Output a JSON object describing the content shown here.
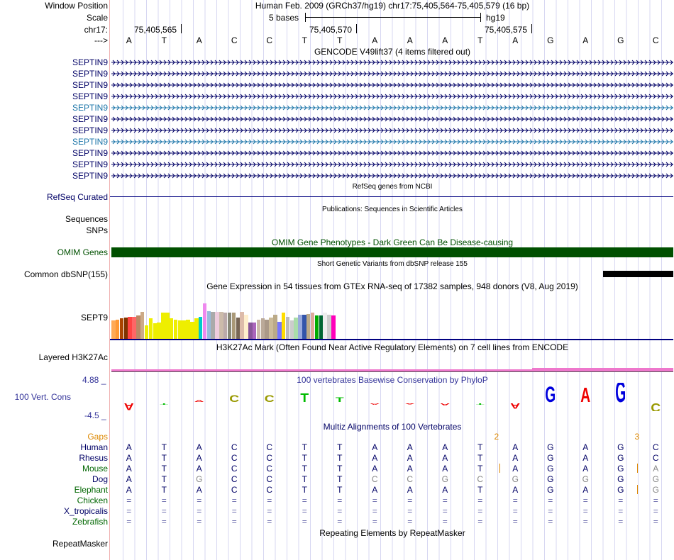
{
  "header": {
    "window_position_label": "Window Position",
    "position_text": "Human Feb. 2009 (GRCh37/hg19)   chr17:75,405,564-75,405,579 (16 bp)",
    "scale_label": "Scale",
    "scale_text": "5 bases",
    "assembly": "hg19",
    "chrom_label": "chr17:",
    "arrow_label": "--->",
    "coords": [
      "75,405,565",
      "75,405,570",
      "75,405,575"
    ]
  },
  "sequence": [
    "A",
    "T",
    "A",
    "C",
    "C",
    "T",
    "T",
    "A",
    "A",
    "A",
    "T",
    "A",
    "G",
    "A",
    "G",
    "C"
  ],
  "gencode": {
    "title": "GENCODE V49lift37 (4 items filtered out)",
    "rows": [
      {
        "label": "SEPTIN9",
        "color": "#000066"
      },
      {
        "label": "SEPTIN9",
        "color": "#000066"
      },
      {
        "label": "SEPTIN9",
        "color": "#000066"
      },
      {
        "label": "SEPTIN9",
        "color": "#000066"
      },
      {
        "label": "SEPTIN9",
        "color": "#1a74a8"
      },
      {
        "label": "SEPTIN9",
        "color": "#000066"
      },
      {
        "label": "SEPTIN9",
        "color": "#000066"
      },
      {
        "label": "SEPTIN9",
        "color": "#1a74a8"
      },
      {
        "label": "SEPTIN9",
        "color": "#000066"
      },
      {
        "label": "SEPTIN9",
        "color": "#000066"
      },
      {
        "label": "SEPTIN9",
        "color": "#000066"
      }
    ]
  },
  "refseq": {
    "label": "RefSeq Curated",
    "title": "RefSeq genes from NCBI"
  },
  "publications": {
    "title": "Publications: Sequences in Scientific Articles",
    "label_sequences": "Sequences",
    "label_snps": "SNPs"
  },
  "omim": {
    "title": "OMIM Gene Phenotypes - Dark Green Can Be Disease-causing",
    "label": "OMIM Genes",
    "color": "#005000"
  },
  "dbsnp": {
    "title": "Short Genetic Variants from dbSNP release 155",
    "label": "Common dbSNP(155)"
  },
  "gtex": {
    "title": "Gene Expression in 54 tissues from GTEx RNA-seq of 17382 samples, 948 donors (V8, Aug 2019)",
    "label": "SEPT9",
    "bars": [
      {
        "h": 0.38,
        "c": "#ffaa55"
      },
      {
        "h": 0.4,
        "c": "#ff9933"
      },
      {
        "h": 0.42,
        "c": "#aa4400"
      },
      {
        "h": 0.44,
        "c": "#7f3300"
      },
      {
        "h": 0.46,
        "c": "#ff4444"
      },
      {
        "h": 0.46,
        "c": "#ff6666"
      },
      {
        "h": 0.48,
        "c": "#bb8866"
      },
      {
        "h": 0.56,
        "c": "#ccaa88"
      },
      {
        "h": 0.28,
        "c": "#eeee00"
      },
      {
        "h": 0.42,
        "c": "#eeee00"
      },
      {
        "h": 0.32,
        "c": "#eeee00"
      },
      {
        "h": 0.34,
        "c": "#eeee00"
      },
      {
        "h": 0.54,
        "c": "#eeee00"
      },
      {
        "h": 0.54,
        "c": "#eeee00"
      },
      {
        "h": 0.42,
        "c": "#eeee00"
      },
      {
        "h": 0.4,
        "c": "#eeee00"
      },
      {
        "h": 0.38,
        "c": "#eeee00"
      },
      {
        "h": 0.38,
        "c": "#eeee00"
      },
      {
        "h": 0.4,
        "c": "#eeee00"
      },
      {
        "h": 0.36,
        "c": "#eeee00"
      },
      {
        "h": 0.42,
        "c": "#eeee00"
      },
      {
        "h": 0.46,
        "c": "#00cccc"
      },
      {
        "h": 0.74,
        "c": "#ee88ee"
      },
      {
        "h": 0.58,
        "c": "#99bbdd"
      },
      {
        "h": 0.56,
        "c": "#aaaaaa"
      },
      {
        "h": 0.56,
        "c": "#eeccdd"
      },
      {
        "h": 0.56,
        "c": "#ccbbaa"
      },
      {
        "h": 0.54,
        "c": "#bbaaaa"
      },
      {
        "h": 0.54,
        "c": "#888877"
      },
      {
        "h": 0.54,
        "c": "#aa9977"
      },
      {
        "h": 0.44,
        "c": "#776655"
      },
      {
        "h": 0.56,
        "c": "#ddbbaa"
      },
      {
        "h": 0.5,
        "c": "#ffeecc"
      },
      {
        "h": 0.34,
        "c": "#885599"
      },
      {
        "h": 0.34,
        "c": "#aa66bb"
      },
      {
        "h": 0.4,
        "c": "#ccbbaa"
      },
      {
        "h": 0.42,
        "c": "#bbaa99"
      },
      {
        "h": 0.4,
        "c": "#aa9988"
      },
      {
        "h": 0.44,
        "c": "#ccbb99"
      },
      {
        "h": 0.5,
        "c": "#bbaa88"
      },
      {
        "h": 0.36,
        "c": "#7777ff"
      },
      {
        "h": 0.54,
        "c": "#ffdd00"
      },
      {
        "h": 0.46,
        "c": "#bbbbbb"
      },
      {
        "h": 0.38,
        "c": "#cccccc"
      },
      {
        "h": 0.44,
        "c": "#aaddaa"
      },
      {
        "h": 0.5,
        "c": "#99aadd"
      },
      {
        "h": 0.5,
        "c": "#3355aa"
      },
      {
        "h": 0.52,
        "c": "#bbaa88"
      },
      {
        "h": 0.54,
        "c": "#ddaa99"
      },
      {
        "h": 0.48,
        "c": "#00aa00"
      },
      {
        "h": 0.48,
        "c": "#006633"
      },
      {
        "h": 0.54,
        "c": "#eeeeee"
      },
      {
        "h": 0.5,
        "c": "#cccccc"
      },
      {
        "h": 0.48,
        "c": "#ff00bb"
      }
    ]
  },
  "h3k27ac": {
    "title": "H3K27Ac Mark (Often Found Near Active Regulatory Elements) on 7 cell lines from ENCODE",
    "label": "Layered H3K27Ac"
  },
  "phylop": {
    "title": "100 vertebrates Basewise Conservation by PhyloP",
    "label": "100 Vert. Cons",
    "max_label": "4.88 _",
    "min_label": "-4.5 _",
    "scores": [
      -0.6,
      -0.1,
      0.15,
      0.6,
      0.6,
      0.8,
      0.4,
      -0.1,
      -0.05,
      -0.2,
      -0.1,
      -0.5,
      1.4,
      1.3,
      3.2,
      -0.8
    ]
  },
  "multiz": {
    "title": "Multiz Alignments of 100 Vertebrates",
    "gaps_label": "Gaps",
    "gap_markers": [
      {
        "after": 10,
        "text": "2"
      },
      {
        "after": 14,
        "text": "3"
      }
    ],
    "species": [
      {
        "name": "Human",
        "color": "#000066",
        "seq": [
          "A",
          "T",
          "A",
          "C",
          "C",
          "T",
          "T",
          "A",
          "A",
          "A",
          "T",
          "A",
          "G",
          "A",
          "G",
          "C"
        ]
      },
      {
        "name": "Rhesus",
        "color": "#000066",
        "seq": [
          "A",
          "T",
          "A",
          "C",
          "C",
          "T",
          "T",
          "A",
          "A",
          "A",
          "T",
          "A",
          "G",
          "A",
          "G",
          "C"
        ]
      },
      {
        "name": "Mouse",
        "color": "#006600",
        "seq": [
          "A",
          "T",
          "A",
          "C",
          "C",
          "T",
          "T",
          "A",
          "A",
          "A",
          "T",
          "A",
          "G",
          "A",
          "G",
          "A"
        ]
      },
      {
        "name": "Dog",
        "color": "#000066",
        "seq": [
          "A",
          "T",
          "G",
          "C",
          "C",
          "T",
          "T",
          "C",
          "C",
          "G",
          "C",
          "G",
          "G",
          "G",
          "G",
          "G"
        ]
      },
      {
        "name": "Elephant",
        "color": "#006600",
        "seq": [
          "A",
          "T",
          "A",
          "C",
          "C",
          "T",
          "T",
          "A",
          "A",
          "A",
          "T",
          "A",
          "G",
          "A",
          "G",
          "G"
        ]
      },
      {
        "name": "Chicken",
        "color": "#006600",
        "seq": [
          "=",
          "=",
          "=",
          "=",
          "=",
          "=",
          "=",
          "=",
          "=",
          "=",
          "=",
          "=",
          "=",
          "=",
          "=",
          "="
        ]
      },
      {
        "name": "X_tropicalis",
        "color": "#000066",
        "seq": [
          "=",
          "=",
          "=",
          "=",
          "=",
          "=",
          "=",
          "=",
          "=",
          "=",
          "=",
          "=",
          "=",
          "=",
          "=",
          "="
        ]
      },
      {
        "name": "Zebrafish",
        "color": "#006600",
        "seq": [
          "=",
          "=",
          "=",
          "=",
          "=",
          "=",
          "=",
          "=",
          "=",
          "=",
          "=",
          "=",
          "=",
          "=",
          "=",
          "="
        ]
      }
    ]
  },
  "repeatmasker": {
    "title": "Repeating Elements by RepeatMasker",
    "label": "RepeatMasker"
  },
  "colors": {
    "navy": "#000066",
    "omim_green": "#005000",
    "pink": "#ee77cc",
    "multiz_gaps": "#dd8800"
  }
}
